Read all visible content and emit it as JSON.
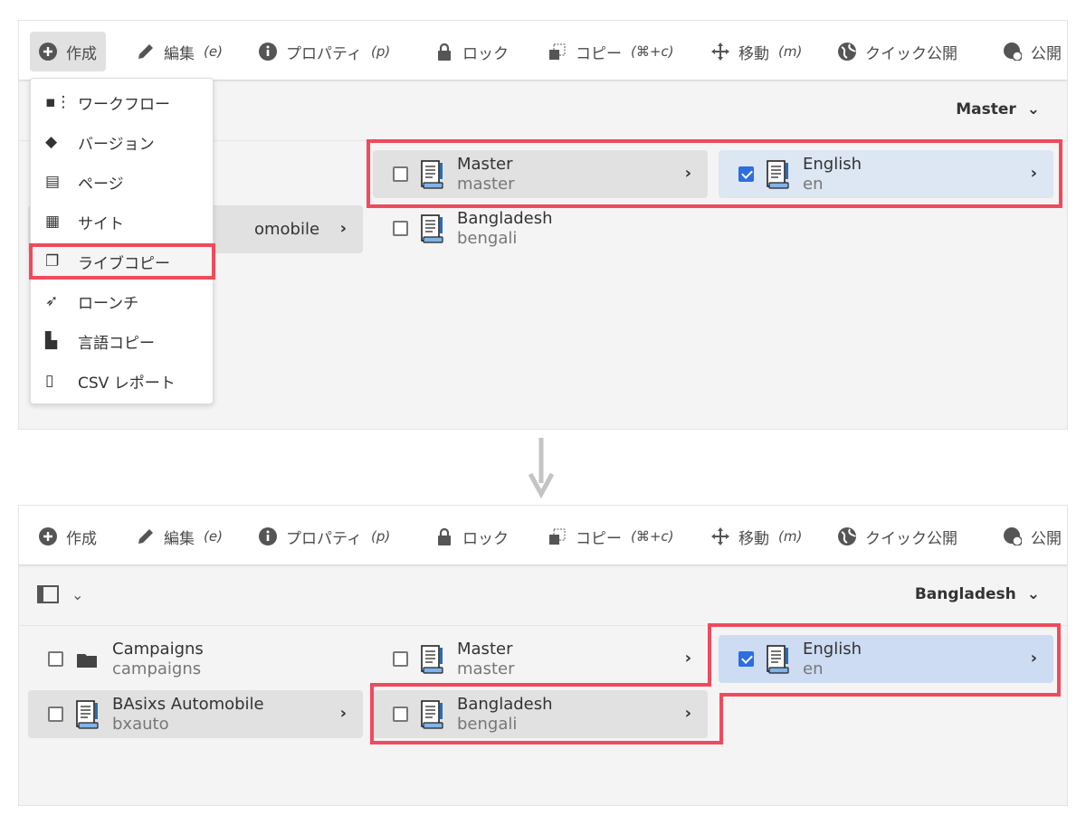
{
  "toolbar": {
    "items": [
      {
        "label": "作成",
        "shortcut": "",
        "icon": "plus-circle-icon"
      },
      {
        "label": "編集",
        "shortcut": "(e)",
        "icon": "pencil-icon"
      },
      {
        "label": "プロパティ",
        "shortcut": "(p)",
        "icon": "info-icon"
      },
      {
        "label": "ロック",
        "shortcut": "",
        "icon": "lock-icon"
      },
      {
        "label": "コピー",
        "shortcut": "(⌘+c)",
        "icon": "copy-icon"
      },
      {
        "label": "移動",
        "shortcut": "(m)",
        "icon": "move-icon"
      },
      {
        "label": "クイック公開",
        "shortcut": "",
        "icon": "globe-icon"
      },
      {
        "label": "公開",
        "shortcut": "",
        "icon": "globe-clock-icon"
      }
    ]
  },
  "menu": {
    "items": [
      {
        "label": "ワークフロー",
        "icon": "workflow-icon"
      },
      {
        "label": "バージョン",
        "icon": "layers-icon"
      },
      {
        "label": "ページ",
        "icon": "page-icon"
      },
      {
        "label": "サイト",
        "icon": "site-icon"
      },
      {
        "label": "ライブコピー",
        "icon": "live-copy-icon",
        "highlighted": true
      },
      {
        "label": "ローンチ",
        "icon": "launch-icon"
      },
      {
        "label": "言語コピー",
        "icon": "language-copy-icon"
      },
      {
        "label": "CSV レポート",
        "icon": "csv-report-icon"
      }
    ]
  },
  "before": {
    "selector": "Master",
    "col1": [
      {
        "title": "omobile"
      }
    ],
    "col2": [
      {
        "title": "Master",
        "name": "master",
        "checked": false
      },
      {
        "title": "Bangladesh",
        "name": "bengali",
        "checked": false
      }
    ],
    "col3": [
      {
        "title": "English",
        "name": "en",
        "checked": true
      }
    ]
  },
  "after": {
    "selector": "Bangladesh",
    "col1": [
      {
        "title": "Campaigns",
        "name": "campaigns",
        "checked": false
      },
      {
        "title": "BAsixs Automobile",
        "name": "bxauto",
        "checked": false
      }
    ],
    "col2": [
      {
        "title": "Master",
        "name": "master",
        "checked": false
      },
      {
        "title": "Bangladesh",
        "name": "bengali",
        "checked": false
      }
    ],
    "col3": [
      {
        "title": "English",
        "name": "en",
        "checked": true
      }
    ]
  },
  "colors": {
    "highlight": "#f04a5c",
    "selected": "#dde6f3",
    "checkbox": "#2d6ee0"
  }
}
